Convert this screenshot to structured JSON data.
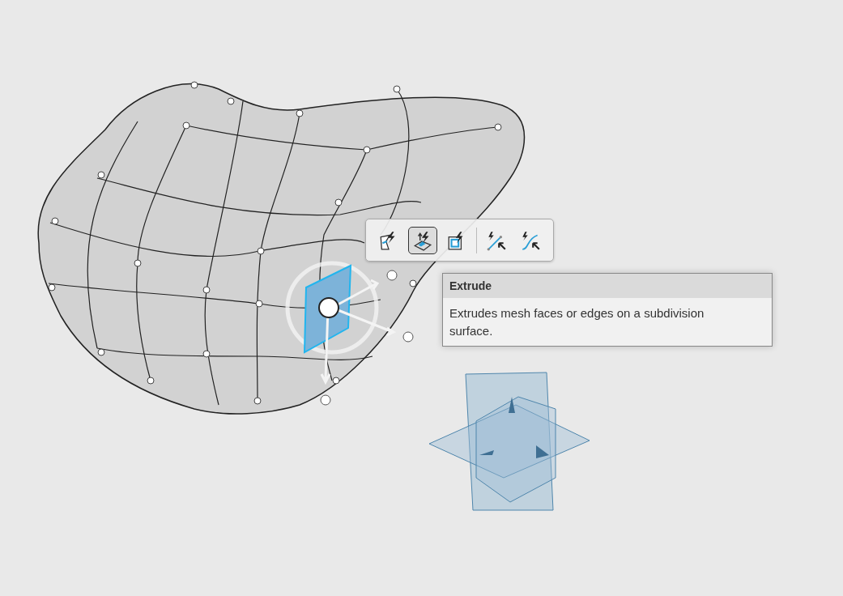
{
  "toolbar": {
    "groups": [
      {
        "tools": [
          {
            "kind": "bridge",
            "selected": false
          },
          {
            "kind": "extrude",
            "selected": true
          },
          {
            "kind": "inset",
            "selected": false
          }
        ]
      },
      {
        "tools": [
          {
            "kind": "edge",
            "selected": false
          },
          {
            "kind": "curve",
            "selected": false
          }
        ]
      }
    ]
  },
  "tooltip": {
    "title": "Extrude",
    "description": "Extrudes mesh faces or edges on a subdivision surface."
  }
}
